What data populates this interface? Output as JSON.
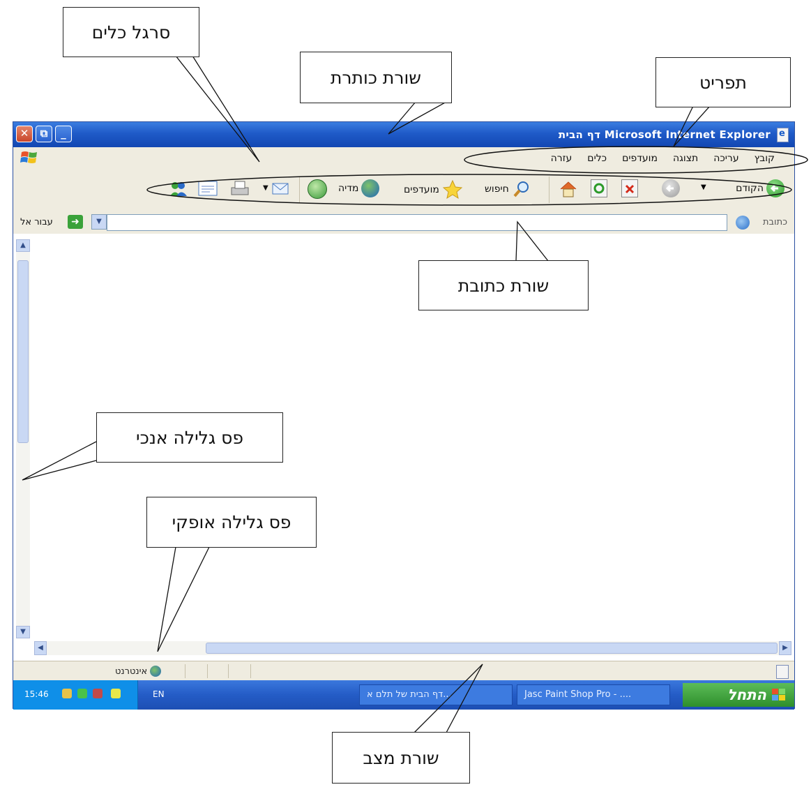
{
  "window": {
    "title": "דף הבית Microsoft Internet Explorer",
    "buttons": {
      "close": "✕",
      "restore": "⧉",
      "minimize": "_"
    }
  },
  "menu": {
    "items": [
      "קובץ",
      "עריכה",
      "תצוגה",
      "מועדפים",
      "כלים",
      "עזרה"
    ]
  },
  "toolbar": {
    "back_label": "הקודם",
    "search_label": "חיפוש",
    "favorites_label": "מועדפים",
    "media_label": "מדיה",
    "icons": [
      "back-icon",
      "forward-icon",
      "stop-icon",
      "refresh-icon",
      "home-icon",
      "search-icon",
      "favorites-icon",
      "media-icon",
      "history-icon",
      "mail-icon",
      "print-icon",
      "edit-icon",
      "messenger-icon"
    ]
  },
  "addressbar": {
    "label": "כתובת",
    "go_label": "עבור אל",
    "value": ""
  },
  "statusbar": {
    "zone": "אינטרנט"
  },
  "taskbar": {
    "start_label": "התחל",
    "tasks": [
      "Jasc Paint Shop Pro - ....",
      "דף הבית של תלם א..."
    ],
    "language": "EN",
    "clock": "15:46"
  },
  "callouts": {
    "toolbar": "סרגל כלים",
    "titlebar": "שורת כותרת",
    "menu": "תפריט",
    "addressbar": "שורת כתובת",
    "vscroll": "פס גלילה אנכי",
    "hscroll": "פס גלילה אופקי",
    "statusbar": "שורת מצב"
  },
  "colors": {
    "titlebar": "#1f5ac8",
    "chrome": "#efece0",
    "start": "#2e8f2c",
    "taskbar": "#245cc6"
  }
}
